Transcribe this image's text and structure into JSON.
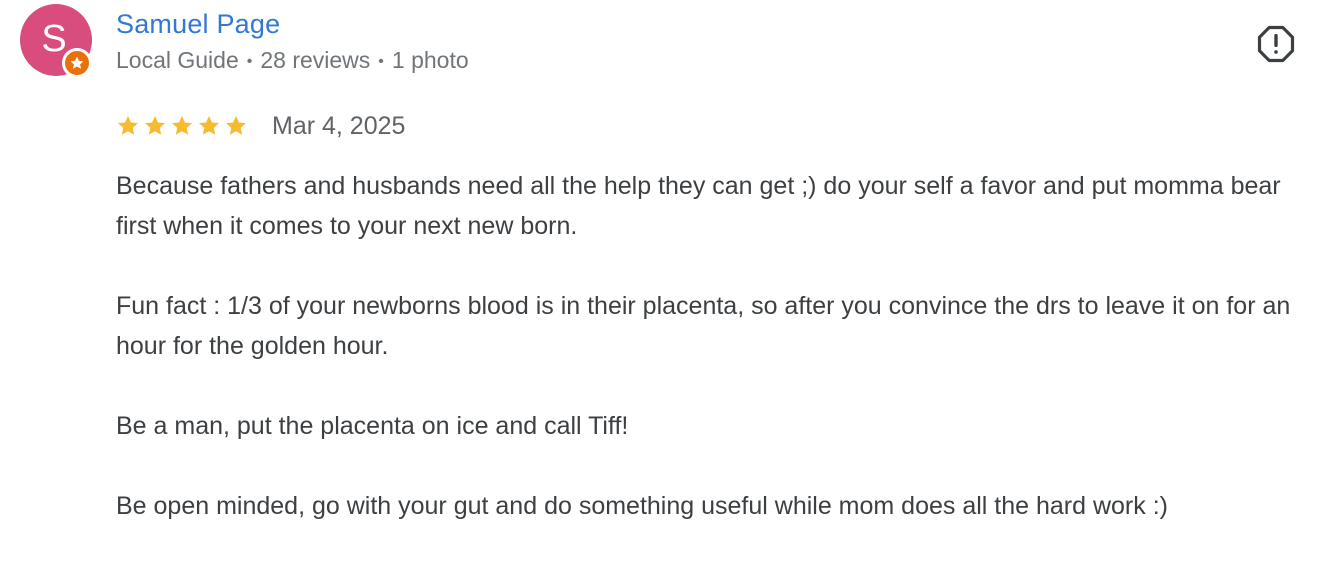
{
  "review": {
    "author": {
      "initial": "S",
      "name": "Samuel Page",
      "badge_icon": "local-guide-star-icon",
      "meta": {
        "level": "Local Guide",
        "reviews": "28 reviews",
        "photos": "1 photo",
        "separator": "•"
      }
    },
    "report_icon": "report-flag-icon",
    "rating": {
      "stars": 5,
      "max_stars": 5
    },
    "date": "Mar 4, 2025",
    "paragraphs": [
      "Because fathers and husbands need all the help they can get ;) do your self a favor and put momma bear first when it comes to your next new born.",
      "Fun fact : 1/3 of your newborns blood is in their placenta, so after you convince the drs to leave it on for an hour for the golden hour.",
      "Be a man, put the placenta on ice and call Tiff!",
      "Be open minded, go with your gut and do something useful while mom does all the hard work :)"
    ]
  },
  "colors": {
    "avatar_bg": "#d94d7e",
    "badge_bg": "#e8710a",
    "name": "#3478d4",
    "star": "#f6bb2f",
    "icon": "#3c4043"
  }
}
